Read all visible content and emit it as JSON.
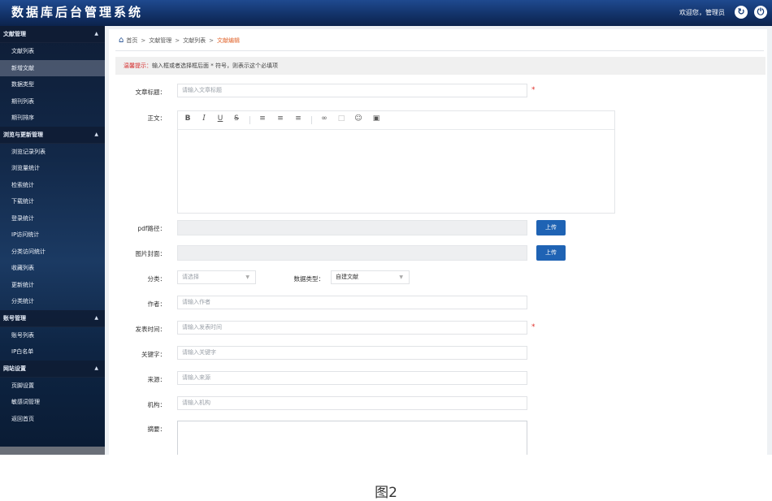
{
  "header": {
    "title": "数据库后台管理系统",
    "welcome": "欢迎您，管理员"
  },
  "sidebar": {
    "sections": [
      {
        "label": "文献管理",
        "items": [
          "文献列表",
          "新增文献",
          "数据类型",
          "期刊列表",
          "期刊排序"
        ]
      },
      {
        "label": "浏览与更新管理",
        "items": [
          "浏览记录列表",
          "浏览量统计",
          "检索统计",
          "下载统计",
          "登录统计",
          "IP访问统计",
          "分类访问统计",
          "收藏列表",
          "更新统计",
          "分类统计"
        ]
      },
      {
        "label": "账号管理",
        "items": [
          "账号列表",
          "IP白名单"
        ]
      },
      {
        "label": "网站设置",
        "items": [
          "页脚设置",
          "敏感词管理",
          "返回首页"
        ]
      }
    ],
    "active_item": "新增文献"
  },
  "breadcrumb": {
    "items": [
      "首页",
      "文献管理",
      "文献列表"
    ],
    "current": "文献编辑",
    "separator": ">"
  },
  "notice": {
    "label": "温馨提示：",
    "text": "输入框或者选择框后面 * 符号，则表示这个必填项"
  },
  "form": {
    "title_label": "文章标题：",
    "title_placeholder": "请输入文章标题",
    "body_label": "正文：",
    "pdf_label": "pdf路径：",
    "cover_label": "图片封面：",
    "upload_label": "上传",
    "category_label": "分类：",
    "category_value": "请选择",
    "datatype_label": "数据类型：",
    "datatype_value": "自建文献",
    "author_label": "作者：",
    "author_placeholder": "请输入作者",
    "pubtime_label": "发表时间：",
    "pubtime_placeholder": "请输入发表时间",
    "keywords_label": "关键字：",
    "keywords_placeholder": "请输入关键字",
    "source_label": "来源：",
    "source_placeholder": "请输入来源",
    "org_label": "机构：",
    "org_placeholder": "请输入机构",
    "abstract_label": "摘要：",
    "required_mark": "*"
  },
  "toolbar_icons": [
    "bold-icon",
    "italic-icon",
    "underline-icon",
    "strikethrough-icon",
    "align-left-icon",
    "align-center-icon",
    "align-right-icon",
    "link-icon",
    "table-icon",
    "emoji-icon",
    "image-icon"
  ],
  "caption": "图2",
  "colors": {
    "header": "#163c78",
    "button": "#1f63b4",
    "accent": "#e0632a",
    "required": "#e0302a"
  }
}
